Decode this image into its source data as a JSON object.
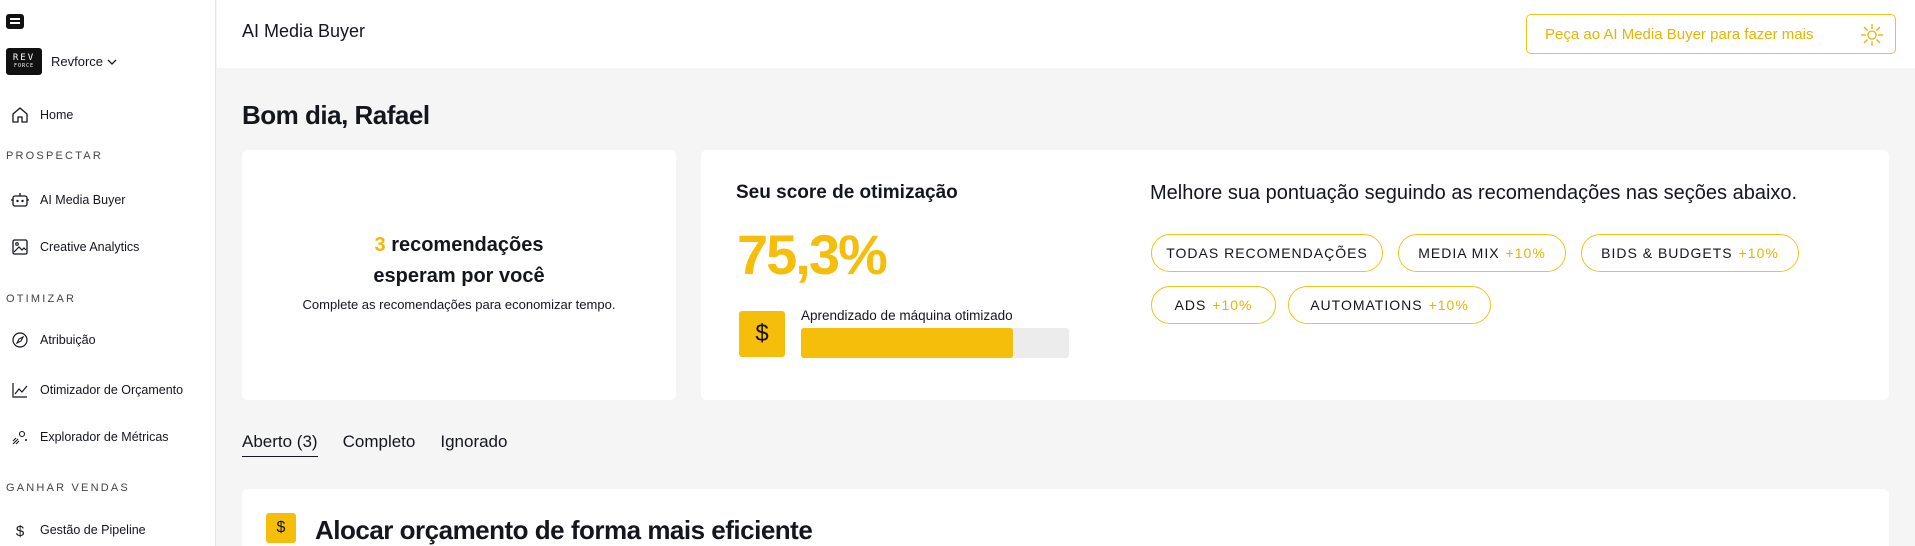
{
  "sidebar": {
    "workspace": {
      "logo_line1": "REV",
      "logo_line2": "FORCE",
      "name": "Revforce"
    },
    "home": {
      "label": "Home",
      "icon": "home-icon"
    },
    "sections": [
      {
        "label": "PROSPECTAR"
      },
      {
        "label": "OTIMIZAR"
      },
      {
        "label": "GANHAR VENDAS"
      }
    ],
    "items": [
      {
        "label": "AI Media Buyer",
        "icon": "robot-icon"
      },
      {
        "label": "Creative Analytics",
        "icon": "image-icon"
      },
      {
        "label": "Atribuição",
        "icon": "compass-icon"
      },
      {
        "label": "Otimizador de Orçamento",
        "icon": "line-chart-icon"
      },
      {
        "label": "Explorador de Métricas",
        "icon": "explore-icon"
      },
      {
        "label": "Gestão de Pipeline",
        "icon": "dollar-icon"
      }
    ]
  },
  "header": {
    "title": "AI Media Buyer",
    "ask_button": "Peça ao AI Media Buyer para fazer mais",
    "ask_icon": "sparkle-icon"
  },
  "main": {
    "greeting": "Bom dia, Rafael",
    "reco_card": {
      "count": "3",
      "title_rest": "recomendações",
      "title_line2": "esperam por você",
      "subtitle": "Complete as recomendações para economizar tempo."
    },
    "score_card": {
      "title": "Seu score de otimização",
      "value": "75,3%",
      "ml_icon": "$",
      "ml_label": "Aprendizado de máquina otimizado",
      "ml_progress": 0.79,
      "improve_text": "Melhore sua pontuação seguindo as recomendações nas seções abaixo.",
      "pills": [
        {
          "label": "TODAS RECOMENDAÇÕES",
          "pct": ""
        },
        {
          "label": "MEDIA MIX",
          "pct": "+10%"
        },
        {
          "label": "BIDS & BUDGETS",
          "pct": "+10%"
        },
        {
          "label": "ADS",
          "pct": "+10%"
        },
        {
          "label": "AUTOMATIONS",
          "pct": "+10%"
        }
      ]
    },
    "tabs": [
      {
        "label": "Aberto (3)",
        "active": true
      },
      {
        "label": "Completo",
        "active": false
      },
      {
        "label": "Ignorado",
        "active": false
      }
    ],
    "bottom_card": {
      "icon": "$",
      "title": "Alocar orçamento de forma mais eficiente"
    }
  },
  "colors": {
    "accent": "#f5be0b",
    "accent_border": "#f2c21a",
    "text": "#14161d",
    "background": "#f5f5f6"
  }
}
